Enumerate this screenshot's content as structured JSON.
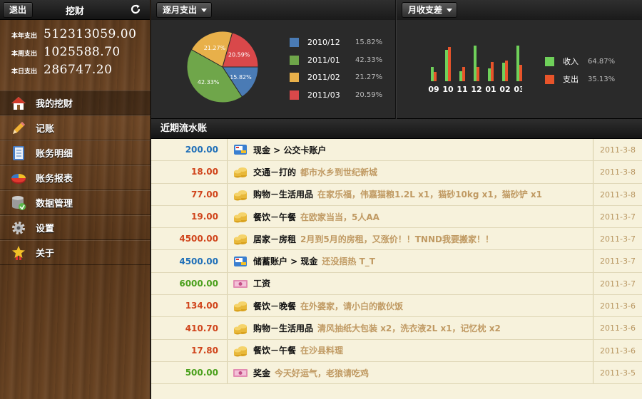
{
  "topbar": {
    "logout_label": "退出",
    "title": "挖财"
  },
  "stats": [
    {
      "label": "本年支出",
      "value": "512313059.00"
    },
    {
      "label": "本周支出",
      "value": "1025588.70"
    },
    {
      "label": "本日支出",
      "value": "286747.20"
    }
  ],
  "menu": [
    {
      "label": "我的挖财",
      "icon": "home-icon"
    },
    {
      "label": "记账",
      "icon": "pencil-icon"
    },
    {
      "label": "账务明细",
      "icon": "notebook-icon"
    },
    {
      "label": "账务报表",
      "icon": "pie-chart-icon"
    },
    {
      "label": "数据管理",
      "icon": "database-icon"
    },
    {
      "label": "设置",
      "icon": "gear-icon"
    },
    {
      "label": "关于",
      "icon": "star-icon"
    }
  ],
  "charts": {
    "monthly_label": "逐月支出",
    "diff_label": "月收支差",
    "pie_legend": [
      {
        "label": "2010/12",
        "pct": "15.82%",
        "color": "#4a7bb5"
      },
      {
        "label": "2011/01",
        "pct": "42.33%",
        "color": "#6fa64a"
      },
      {
        "label": "2011/02",
        "pct": "21.27%",
        "color": "#e8b04a"
      },
      {
        "label": "2011/03",
        "pct": "20.59%",
        "color": "#d9484a"
      }
    ],
    "bar_legend": [
      {
        "label": "收入",
        "pct": "64.87%",
        "color": "#6fd05a"
      },
      {
        "label": "支出",
        "pct": "35.13%",
        "color": "#e8542a"
      }
    ]
  },
  "chart_data": [
    {
      "type": "pie",
      "categories": [
        "2010/12",
        "2011/01",
        "2011/02",
        "2011/03"
      ],
      "values": [
        15.82,
        42.33,
        21.27,
        20.59
      ],
      "labels": [
        "15.82%",
        "42.33%",
        "21.27%",
        "20.59%"
      ]
    },
    {
      "type": "bar",
      "categories": [
        "09",
        "10",
        "11",
        "12",
        "01",
        "02",
        "03"
      ],
      "series": [
        {
          "name": "收入",
          "values": [
            20,
            44,
            14,
            50,
            18,
            26,
            50
          ]
        },
        {
          "name": "支出",
          "values": [
            13,
            48,
            20,
            20,
            27,
            29,
            23
          ]
        }
      ]
    }
  ],
  "ledger": {
    "title": "近期流水账",
    "rows": [
      {
        "amount": "200.00",
        "kind": "tr",
        "icon": "card-icon",
        "desc": "现金 > 公交卡账户",
        "note": "",
        "date": "2011-3-8"
      },
      {
        "amount": "18.00",
        "kind": "exp",
        "icon": "coins-icon",
        "desc": "交通－打的",
        "note": "都市水乡到世纪新城",
        "date": "2011-3-8"
      },
      {
        "amount": "77.00",
        "kind": "exp",
        "icon": "coins-icon",
        "desc": "购物－生活用品",
        "note": "在家乐福，伟嘉猫粮1.2L x1，猫砂10kg x1，猫砂铲 x1",
        "date": "2011-3-8"
      },
      {
        "amount": "19.00",
        "kind": "exp",
        "icon": "coins-icon",
        "desc": "餐饮－午餐",
        "note": "在欧家当当，5人AA",
        "date": "2011-3-7"
      },
      {
        "amount": "4500.00",
        "kind": "exp",
        "icon": "coins-icon",
        "desc": "居家－房租",
        "note": "2月到5月的房租，又涨价！！TNND我要搬家！！",
        "date": "2011-3-7"
      },
      {
        "amount": "4500.00",
        "kind": "tr",
        "icon": "card-icon",
        "desc": "储蓄账户 > 现金",
        "note": "还没捂热 T_T",
        "date": "2011-3-7"
      },
      {
        "amount": "6000.00",
        "kind": "inc",
        "icon": "cash-icon",
        "desc": "工资",
        "note": "",
        "date": "2011-3-7"
      },
      {
        "amount": "134.00",
        "kind": "exp",
        "icon": "coins-icon",
        "desc": "餐饮－晚餐",
        "note": "在外婆家，请小白的散伙饭",
        "date": "2011-3-6"
      },
      {
        "amount": "410.70",
        "kind": "exp",
        "icon": "coins-icon",
        "desc": "购物－生活用品",
        "note": "清风抽纸大包装 x2，洗衣液2L x1，记忆枕 x2",
        "date": "2011-3-6"
      },
      {
        "amount": "17.80",
        "kind": "exp",
        "icon": "coins-icon",
        "desc": "餐饮－午餐",
        "note": "在沙县料理",
        "date": "2011-3-6"
      },
      {
        "amount": "500.00",
        "kind": "inc",
        "icon": "cash-icon",
        "desc": "奖金",
        "note": "今天好运气，老狼请吃鸡",
        "date": "2011-3-5"
      }
    ]
  }
}
